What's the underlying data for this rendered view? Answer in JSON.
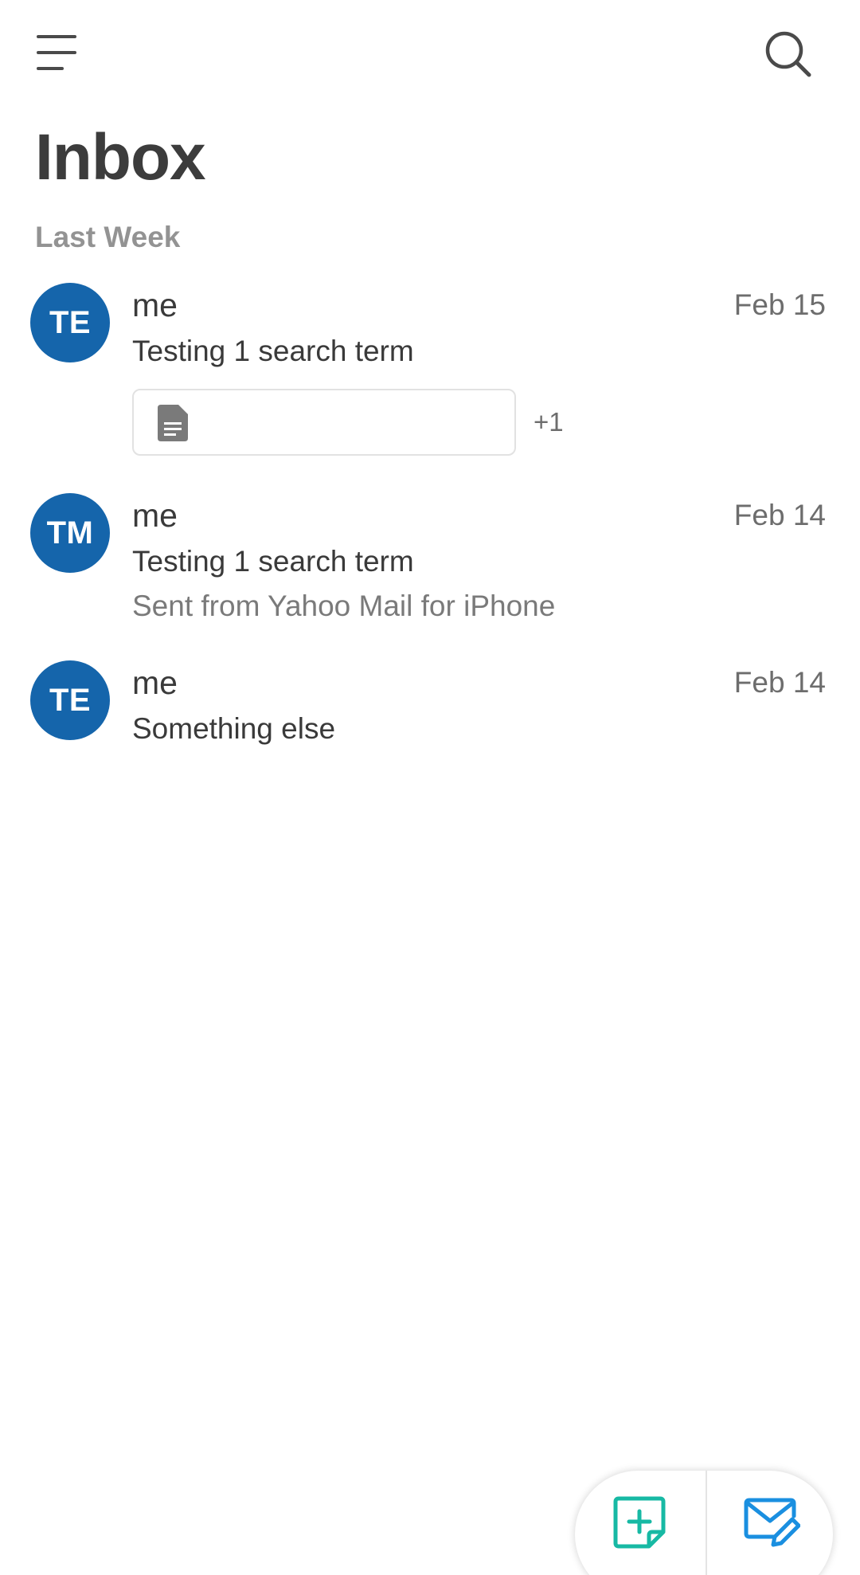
{
  "header": {
    "title": "Inbox",
    "menu_icon": "hamburger-menu-icon",
    "search_icon": "search-icon"
  },
  "sections": [
    {
      "label": "Last Week",
      "messages": [
        {
          "initials": "TE",
          "sender": "me",
          "date": "Feb 15",
          "subject": "Testing 1 search term",
          "preview": "",
          "attachment_icon": "document-icon",
          "attachment_extra": "+1"
        },
        {
          "initials": "TM",
          "sender": "me",
          "date": "Feb 14",
          "subject": "Testing 1 search term",
          "preview": "Sent from Yahoo Mail for iPhone"
        },
        {
          "initials": "TE",
          "sender": "me",
          "date": "Feb 14",
          "subject": "Something else",
          "preview": ""
        }
      ]
    }
  ],
  "fab": {
    "new_item_icon": "add-note-icon",
    "compose_icon": "compose-mail-icon"
  },
  "colors": {
    "avatar": "#1565ab",
    "add_note_accent": "#17b9a4",
    "compose_accent": "#1a8fe0",
    "title_text": "#3c3c3c",
    "section_label": "#939393"
  }
}
